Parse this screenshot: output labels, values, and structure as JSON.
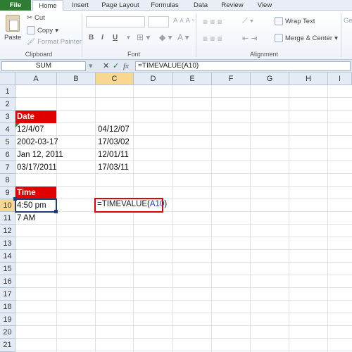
{
  "tabs": [
    "File",
    "Home",
    "Insert",
    "Page Layout",
    "Formulas",
    "Data",
    "Review",
    "View"
  ],
  "clipboard": {
    "paste": "Paste",
    "cut": "Cut",
    "copy": "Copy",
    "format_painter": "Format Painter",
    "group_label": "Clipboard"
  },
  "font": {
    "bold": "B",
    "italic": "I",
    "underline": "U",
    "group_label": "Font"
  },
  "alignment": {
    "wrap_text": "Wrap Text",
    "merge_center": "Merge & Center",
    "group_label": "Alignment"
  },
  "number_partial": "Ge",
  "formula_bar": {
    "name_box": "SUM",
    "cancel": "✕",
    "enter": "✓",
    "fx": "fx",
    "formula": "=TIMEVALUE(A10)"
  },
  "columns": [
    "A",
    "B",
    "C",
    "D",
    "E",
    "F",
    "G",
    "H",
    "I"
  ],
  "rows": [
    "1",
    "2",
    "3",
    "4",
    "5",
    "6",
    "7",
    "8",
    "9",
    "10",
    "11",
    "12",
    "13",
    "14",
    "15",
    "16",
    "17",
    "18",
    "19",
    "20",
    "21"
  ],
  "cells": {
    "A3": "Date",
    "A4": "12/4/07",
    "A5": "2002-03-17",
    "A6": "Jan 12, 2011",
    "A7": "03/17/2011",
    "A9": "Time",
    "A10": "4:50 pm",
    "A11": "7 AM",
    "C4": "04/12/07",
    "C5": "17/03/02",
    "C6": "12/01/11",
    "C7": "17/03/11",
    "C10_func": "=TIMEVALUE(",
    "C10_ref": "A10",
    "C10_close": ")"
  },
  "colors": {
    "file_tab": "#2e7d32",
    "header_fill": "#e00000",
    "edit_border": "#e00000",
    "reference_text": "#1a3cc8",
    "selected_header": "#f8d890"
  }
}
